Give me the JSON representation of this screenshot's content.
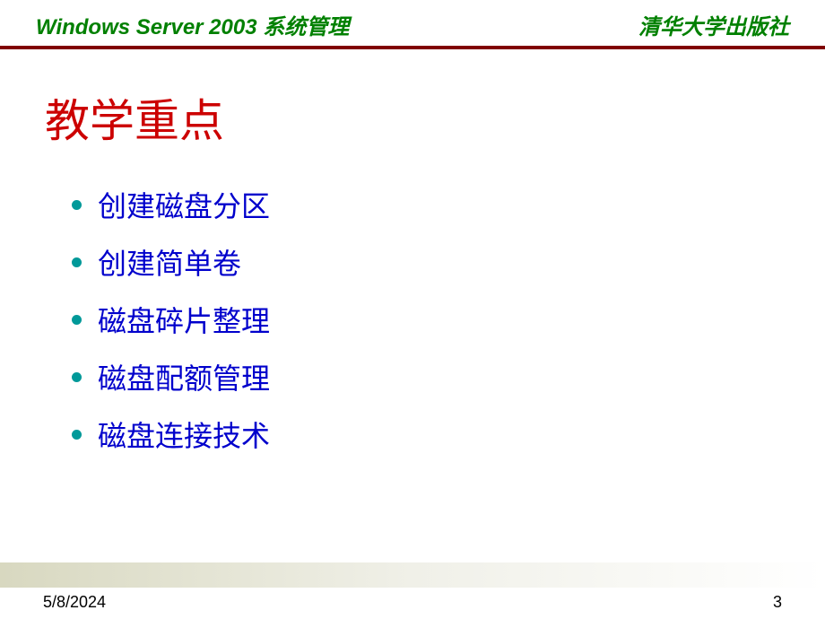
{
  "header": {
    "left": "Windows Server 2003 系统管理",
    "right": "清华大学出版社"
  },
  "title": "教学重点",
  "bullets": [
    "创建磁盘分区",
    "创建简单卷",
    "磁盘碎片整理",
    "磁盘配额管理",
    "磁盘连接技术"
  ],
  "footer": {
    "date": "5/8/2024",
    "page": "3"
  }
}
